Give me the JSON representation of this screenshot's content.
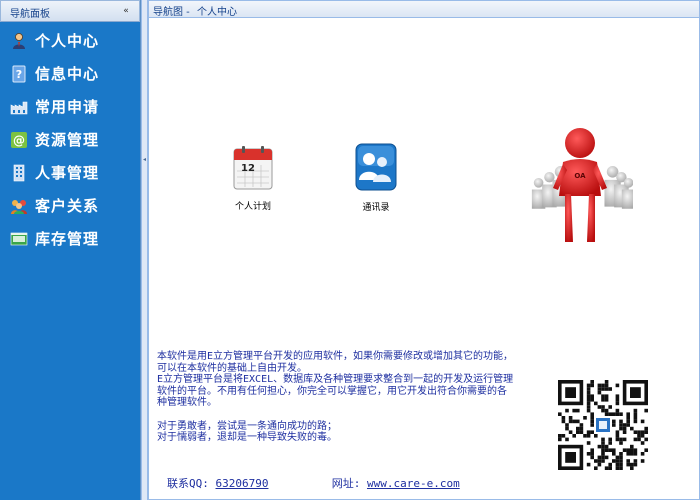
{
  "nav": {
    "title": "导航面板",
    "collapse_glyph": "«",
    "items": [
      {
        "label": "个人中心",
        "icon": "person-icon"
      },
      {
        "label": "信息中心",
        "icon": "help-book-icon"
      },
      {
        "label": "常用申请",
        "icon": "factory-icon"
      },
      {
        "label": "资源管理",
        "icon": "at-sign-icon"
      },
      {
        "label": "人事管理",
        "icon": "building-icon"
      },
      {
        "label": "客户关系",
        "icon": "users-icon"
      },
      {
        "label": "库存管理",
        "icon": "storage-icon"
      }
    ]
  },
  "main": {
    "breadcrumb": {
      "prefix": "导航图 -",
      "current": "个人中心"
    },
    "shortcuts": [
      {
        "label": "个人计划",
        "icon": "calendar-icon",
        "calendar_day": "12"
      },
      {
        "label": "通讯录",
        "icon": "contacts-icon"
      }
    ],
    "mascot_badge": "OA",
    "paragraphs": [
      "本软件是用E立方管理平台开发的应用软件，如果你需要修改或增加其它的功能，",
      "可以在本软件的基础上自由开发。",
      "E立方管理平台是将EXCEL、数据库及各种管理要求整合到一起的开发及运行管理",
      "软件的平台。不用有任何担心，你完全可以掌握它，用它开发出符合你需要的各",
      "种管理软件。",
      "对于勇敢者，尝试是一条通向成功的路；",
      "对于懦弱者，退却是一种导致失败的毒。"
    ],
    "contact": {
      "qq_label": "联系QQ:",
      "qq_value": "63206790",
      "site_label": "网址:",
      "site_value": "www.care-e.com"
    }
  },
  "colors": {
    "nav_bg": "#1a78c8",
    "text_blue": "#1e2fa0",
    "header_text": "#15428b"
  }
}
